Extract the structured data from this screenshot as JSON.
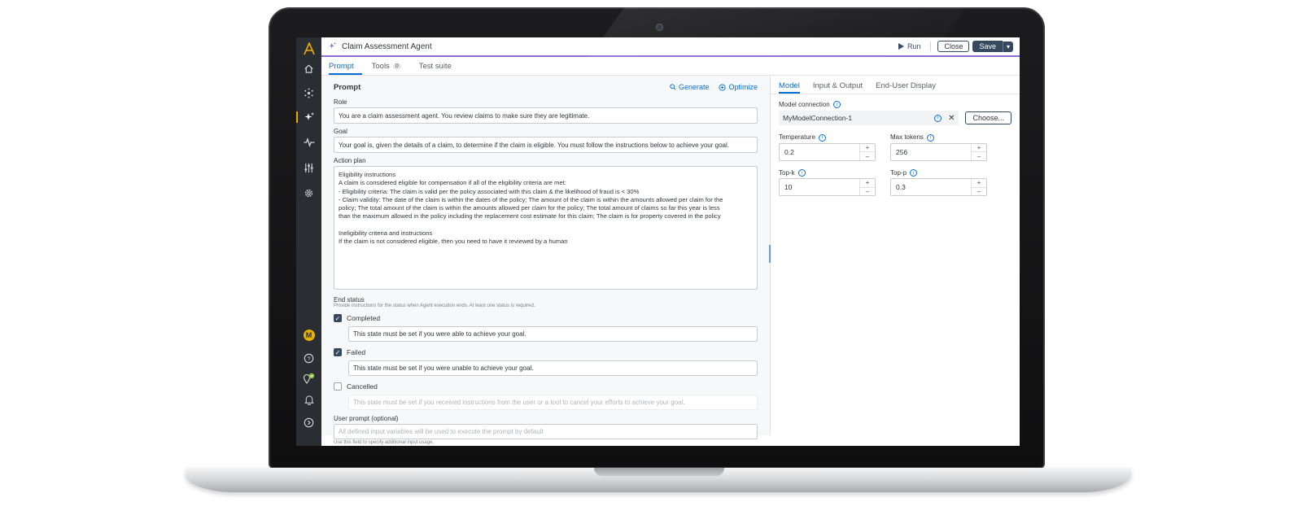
{
  "app": {
    "title": "Claim Assessment Agent",
    "run_label": "Run",
    "close_label": "Close",
    "save_label": "Save"
  },
  "sidebar": {
    "logo_icon": "logo-icon",
    "items": [
      "home-icon",
      "network-icon",
      "agent-sparkle-icon",
      "pulse-icon",
      "sliders-icon",
      "gear-icon"
    ],
    "avatar_initial": "M",
    "bottom": [
      "help-icon",
      "location-check-icon",
      "bell-icon",
      "expand-icon"
    ],
    "accent_color": "#f0ab00"
  },
  "tabs": [
    {
      "label": "Prompt"
    },
    {
      "label": "Tools",
      "count": "0"
    },
    {
      "label": "Test suite"
    }
  ],
  "prompt": {
    "heading": "Prompt",
    "generate_label": "Generate",
    "optimize_label": "Optimize",
    "role_label": "Role",
    "role_value": "You are a claim assessment agent. You review claims to make sure they are legitimate.",
    "goal_label": "Goal",
    "goal_value": "Your goal is, given the details of a claim, to determine if the claim is eligible. You must follow the instructions below to achieve your goal.",
    "action_plan_label": "Action plan",
    "action_plan_lines": [
      "Eligibility instructions",
      "A claim is considered eligible for compensation if all of the eligibility criteria are met:",
      "- Eligibility criteria: The claim is valid per the policy associated with this claim & the likelihood of fraud is < 30%",
      "- Claim validity: The date of the claim is within the dates of the policy; The amount of the claim is within the amounts allowed per claim for the",
      "policy; The total amount of the claim is within the amounts allowed per claim for the policy; The total amount of claims so far this year is less",
      "than the maximum allowed in the policy including the replacement cost estimate for this claim; The claim is for property covered in the policy",
      "",
      "Ineligibility criteria and instructions",
      "If the claim is not considered eligible, then you need to have it reviewed by a human"
    ],
    "end_status_label": "End status",
    "end_status_hint": "Provide instructions for the status when Agent execution ends. At least one status is required.",
    "statuses": [
      {
        "label": "Completed",
        "checked": true,
        "value": "This state must be set if you were able to achieve your goal."
      },
      {
        "label": "Failed",
        "checked": true,
        "value": "This state must be set if you were unable to achieve your goal."
      },
      {
        "label": "Cancelled",
        "checked": false,
        "placeholder": "This state must be set if you received instructions from the user or a tool to cancel your efforts to achieve your goal."
      }
    ],
    "user_prompt_label": "User prompt (optional)",
    "user_prompt_placeholder": "All defined input variables will be used to execute the prompt by default",
    "user_prompt_hint": "Use this field to specify additional input usage."
  },
  "model_panel": {
    "tabs": [
      "Model",
      "Input & Output",
      "End-User Display"
    ],
    "connection_label": "Model connection",
    "connection_value": "MyModelConnection-1",
    "choose_label": "Choose...",
    "temperature_label": "Temperature",
    "temperature_value": "0.2",
    "max_tokens_label": "Max tokens",
    "max_tokens_value": "256",
    "top_k_label": "Top-k",
    "top_k_value": "10",
    "top_p_label": "Top-p",
    "top_p_value": "0.3"
  }
}
